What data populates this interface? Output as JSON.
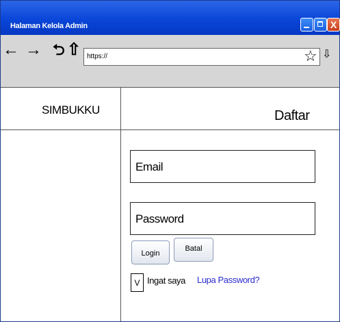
{
  "window": {
    "title": "Halaman Kelola Admin",
    "close_glyph": "X"
  },
  "toolbar": {
    "back_icon": "←",
    "forward_icon": "→",
    "refresh_icon": "⮌",
    "home_icon": "⇧",
    "address_value": "https://",
    "star_icon": "☆",
    "download_icon": "⇩"
  },
  "sidebar": {
    "brand": "SIMBUKKU"
  },
  "main": {
    "heading": "Daftar",
    "email_label": "Email",
    "password_label": "Password",
    "login_label": "Login",
    "cancel_label": "Batal",
    "remember_check": "V",
    "remember_label": "Ingat saya",
    "forgot_label": "Lupa Password?"
  },
  "colors": {
    "titlebar": "#0a46d8",
    "toolbar": "#d6d6d6",
    "link": "#2a2ad0"
  }
}
